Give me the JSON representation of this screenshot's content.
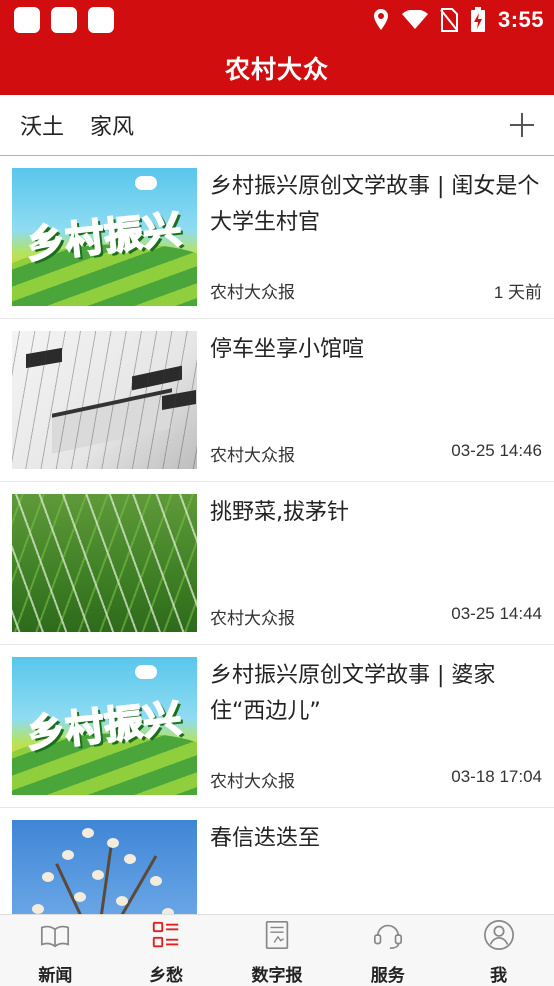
{
  "status_bar": {
    "time": "3:55"
  },
  "header": {
    "title": "农村大众"
  },
  "channels": {
    "tabs": [
      {
        "label": "沃土"
      },
      {
        "label": "家风"
      }
    ]
  },
  "news": {
    "items": [
      {
        "title": "乡村振兴原创文学故事 | 闺女是个大学生村官",
        "source": "农村大众报",
        "time": "1 天前",
        "thumb_text": "乡村振兴"
      },
      {
        "title": "停车坐享小馆喧",
        "source": "农村大众报",
        "time": "03-25 14:46"
      },
      {
        "title": "挑野菜,拔茅针",
        "source": "农村大众报",
        "time": "03-25 14:44"
      },
      {
        "title": "乡村振兴原创文学故事 | 婆家住“西边儿”",
        "source": "农村大众报",
        "time": "03-18 17:04",
        "thumb_text": "乡村振兴"
      },
      {
        "title": "春信迭迭至",
        "source": "",
        "time": ""
      }
    ]
  },
  "bottom_nav": {
    "items": [
      {
        "label": "新闻",
        "icon": "book-icon"
      },
      {
        "label": "乡愁",
        "icon": "list-icon"
      },
      {
        "label": "数字报",
        "icon": "newspaper-icon"
      },
      {
        "label": "服务",
        "icon": "headset-icon"
      },
      {
        "label": "我",
        "icon": "user-icon"
      }
    ],
    "active_index": 1
  },
  "colors": {
    "brand_red": "#d20d0f",
    "active_icon": "#e0201f",
    "inactive_icon": "#888888"
  }
}
